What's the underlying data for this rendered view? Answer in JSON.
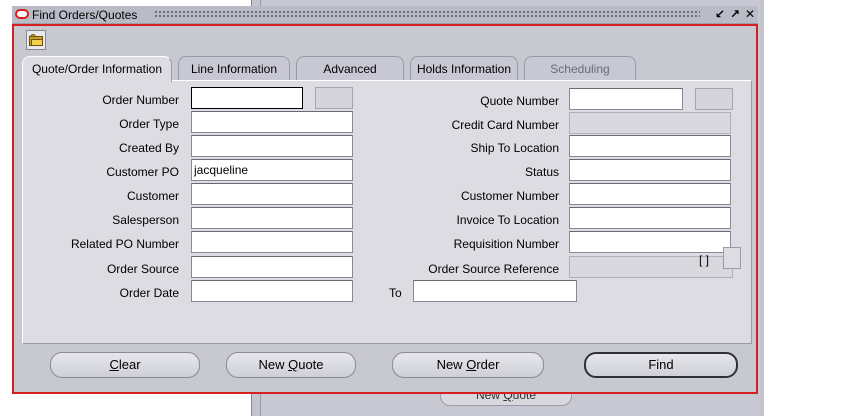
{
  "window": {
    "title": "Find  Orders/Quotes",
    "controls": [
      "↙",
      "↗",
      "✕"
    ]
  },
  "background": {
    "button_label_pre": "New ",
    "button_label_u": "Q",
    "button_label_post": "uote"
  },
  "tabs": [
    {
      "label": "Quote/Order Information",
      "state": "active"
    },
    {
      "label": "Line Information",
      "state": "normal"
    },
    {
      "label": "Advanced",
      "state": "normal"
    },
    {
      "label": "Holds Information",
      "state": "normal"
    },
    {
      "label": "Scheduling",
      "state": "disabled"
    }
  ],
  "fields_left": [
    {
      "label": "Order Number",
      "value": ""
    },
    {
      "label": "Order Type",
      "value": ""
    },
    {
      "label": "Created By",
      "value": ""
    },
    {
      "label": "Customer PO",
      "value": "jacqueline"
    },
    {
      "label": "Customer",
      "value": ""
    },
    {
      "label": "Salesperson",
      "value": ""
    },
    {
      "label": "Related PO Number",
      "value": ""
    },
    {
      "label": "Order Source",
      "value": ""
    },
    {
      "label": "Order Date",
      "value": ""
    }
  ],
  "fields_right": [
    {
      "label": "Quote Number",
      "value": ""
    },
    {
      "label": "Credit Card Number",
      "value": ""
    },
    {
      "label": "Ship To Location",
      "value": ""
    },
    {
      "label": "Status",
      "value": ""
    },
    {
      "label": "Customer Number",
      "value": ""
    },
    {
      "label": "Invoice To Location",
      "value": ""
    },
    {
      "label": "Requisition Number",
      "value": ""
    },
    {
      "label": "Order Source Reference",
      "value": ""
    }
  ],
  "to_field": {
    "label": "To",
    "value": ""
  },
  "bracket_text": "[ ]",
  "buttons": {
    "clear": {
      "u": "C",
      "rest": "lear"
    },
    "new_quote": {
      "pre": "New ",
      "u": "Q",
      "rest": "uote"
    },
    "new_order": {
      "pre": "New ",
      "u": "O",
      "rest": "rder"
    },
    "find": {
      "label": "Find"
    }
  },
  "colors": {
    "focus_frame": "#d42020",
    "window_bg": "#c8c8d0",
    "panel_bg": "#dcdce2"
  },
  "icons": {
    "toolbar": "folder-open-icon",
    "title": "oracle-logo-icon"
  }
}
